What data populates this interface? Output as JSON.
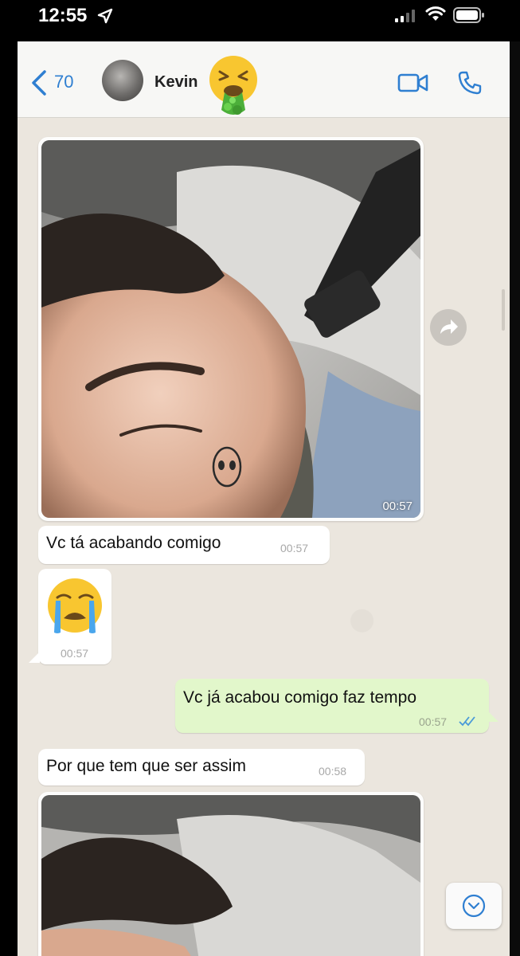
{
  "status_bar": {
    "time": "12:55"
  },
  "header": {
    "back_count": "70",
    "contact_name": "Kevin",
    "name_emoji": "vomit-face-emoji"
  },
  "messages": {
    "photo1_time": "00:57",
    "msg1_text": "Vc tá acabando comigo",
    "msg1_time": "00:57",
    "msg2_emoji": "loudly-crying-face-emoji",
    "msg2_time": "00:57",
    "msg3_text": "Vc já acabou comigo faz tempo",
    "msg3_time": "00:57",
    "msg4_text": "Por que tem que ser assim",
    "msg4_time": "00:58"
  },
  "colors": {
    "accent_blue": "#2f7fd1",
    "outgoing_bubble": "#e2f7cb",
    "incoming_bubble": "#ffffff",
    "chat_background": "#ebe6de"
  }
}
